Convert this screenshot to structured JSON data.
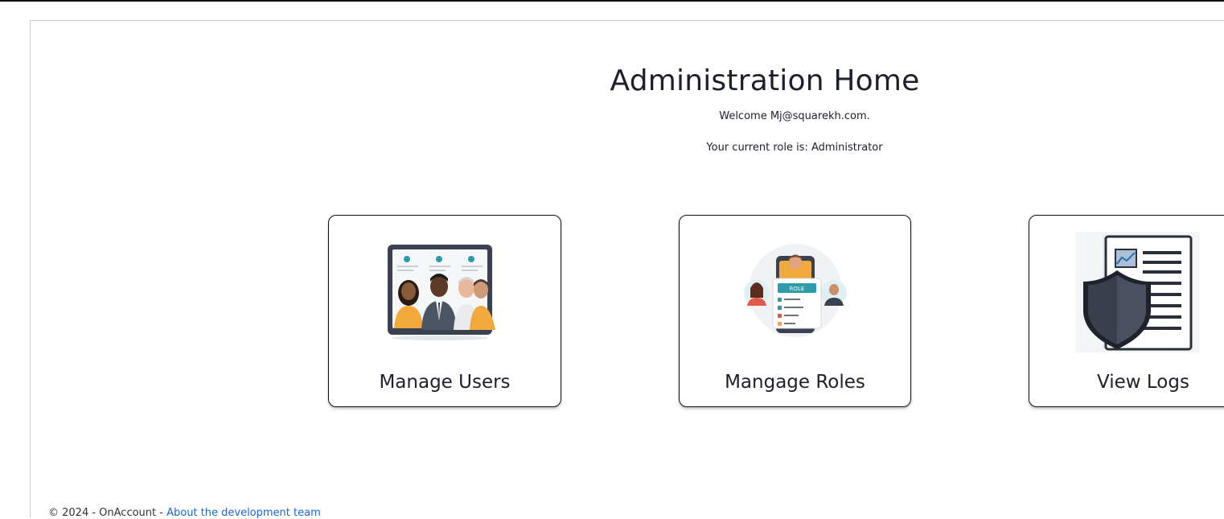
{
  "page": {
    "title": "Administration Home",
    "welcome": "Welcome Mj@squarekh.com.",
    "role_line": "Your current role is: Administrator"
  },
  "cards": [
    {
      "label": "Manage Users",
      "icon": "users-video-call-illustration"
    },
    {
      "label": "Mangage Roles",
      "icon": "role-document-illustration"
    },
    {
      "label": "View Logs",
      "icon": "shield-document-illustration"
    }
  ],
  "footer": {
    "copyright": "© 2024 - OnAccount - ",
    "link_text": "About the development team"
  },
  "colors": {
    "link": "#1a66d6",
    "accent_orange": "#f0a93a",
    "accent_teal": "#2f9aa8",
    "shield_dark": "#3e4350"
  }
}
